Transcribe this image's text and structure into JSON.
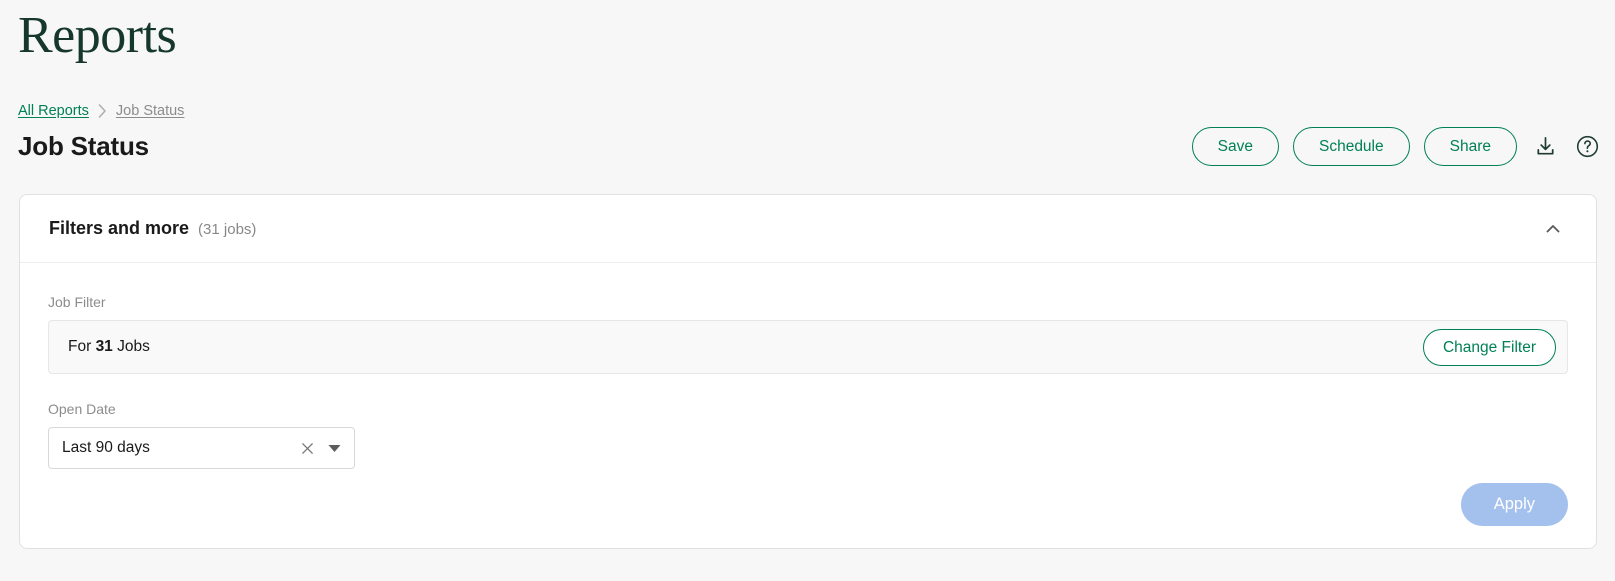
{
  "page": {
    "heading": "Reports"
  },
  "breadcrumb": {
    "root_label": "All Reports",
    "separator": "›",
    "current_label": "Job Status"
  },
  "header": {
    "title": "Job Status",
    "actions": {
      "save_label": "Save",
      "schedule_label": "Schedule",
      "share_label": "Share",
      "download_icon": "download-icon",
      "help_icon": "help-circle-icon"
    }
  },
  "filters_card": {
    "title": "Filters and more",
    "job_count_label": "(31 jobs)",
    "collapse_icon": "chevron-up-icon",
    "job_filter": {
      "label": "Job Filter",
      "prefix": "For",
      "count": "31",
      "suffix": "Jobs",
      "change_button_label": "Change Filter"
    },
    "open_date": {
      "label": "Open Date",
      "value": "Last 90 days",
      "clear_icon": "close-x-icon",
      "dropdown_icon": "caret-down-icon"
    },
    "apply_button_label": "Apply"
  },
  "colors": {
    "brand_green": "#018055",
    "heading_green": "#16372b",
    "page_background": "#f7f7f7",
    "card_background": "#ffffff",
    "apply_disabled": "#a4c0ec",
    "muted_text": "#8c8c8c"
  }
}
